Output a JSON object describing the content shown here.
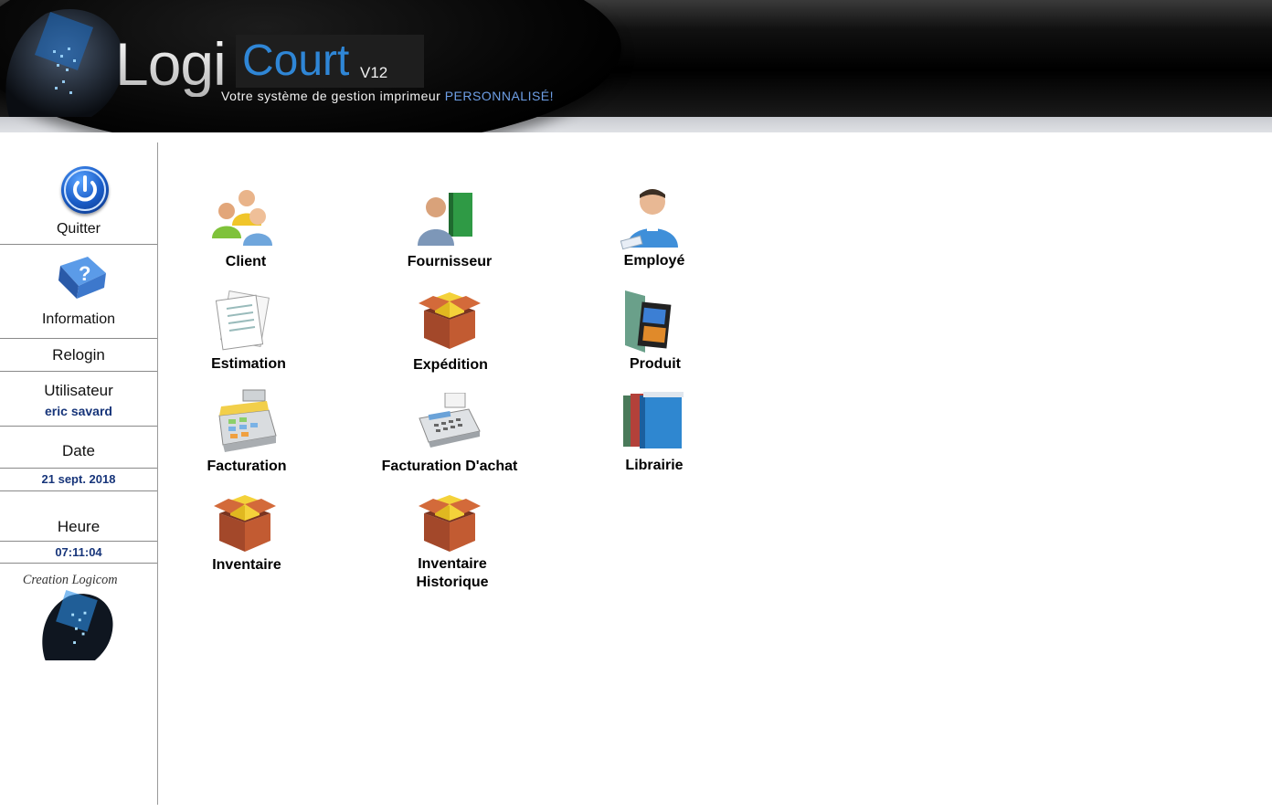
{
  "header": {
    "logo_part1": "Logi",
    "logo_part2": "Court",
    "version": "V12",
    "tagline": "Votre système de gestion imprimeur",
    "tagline_accent": "PERSONNALISÉ!"
  },
  "sidebar": {
    "quit_label": "Quitter",
    "info_label": "Information",
    "relogin_label": "Relogin",
    "user_label": "Utilisateur",
    "user_value": "eric savard",
    "date_label": "Date",
    "date_value": "21 sept. 2018",
    "time_label": "Heure",
    "time_value": "07:11:04",
    "brand_text": "Creation Logicom"
  },
  "modules": [
    {
      "label": "Client",
      "icon": "users-group-icon"
    },
    {
      "label": "Fournisseur",
      "icon": "supplier-icon"
    },
    {
      "label": "Employé",
      "icon": "employee-icon"
    },
    {
      "label": "Estimation",
      "icon": "documents-icon"
    },
    {
      "label": "Expédition",
      "icon": "package-icon"
    },
    {
      "label": "Produit",
      "icon": "product-icon"
    },
    {
      "label": "Facturation",
      "icon": "cash-register-icon"
    },
    {
      "label": "Facturation D'achat",
      "icon": "calculator-icon"
    },
    {
      "label": "Librairie",
      "icon": "books-icon"
    },
    {
      "label": "Inventaire",
      "icon": "package-icon"
    },
    {
      "label": "Inventaire Historique",
      "icon": "package-icon"
    }
  ],
  "colors": {
    "accent_blue": "#2f86d6",
    "sidebar_value": "#17357a",
    "tagline_accent": "#6e9fe6"
  }
}
